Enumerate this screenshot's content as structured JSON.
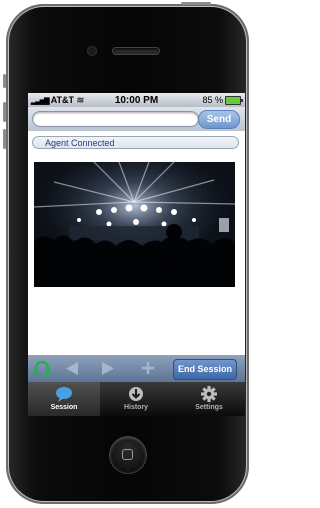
{
  "status_bar": {
    "carrier": "AT&T",
    "time": "10:00 PM",
    "battery": "85 %"
  },
  "message_bar": {
    "input_value": "",
    "send_label": "Send"
  },
  "agent_status": "Agent Connected",
  "toolbar": {
    "end_session_label": "End Session"
  },
  "tabs": [
    {
      "label": "Session",
      "icon": "chat-bubble-icon",
      "active": true
    },
    {
      "label": "History",
      "icon": "download-arrow-icon",
      "active": false
    },
    {
      "label": "Settings",
      "icon": "gear-icon",
      "active": false
    }
  ],
  "colors": {
    "accent": "#6e97cf",
    "toolbar": "#6f86a8",
    "headset": "#22b14c"
  }
}
